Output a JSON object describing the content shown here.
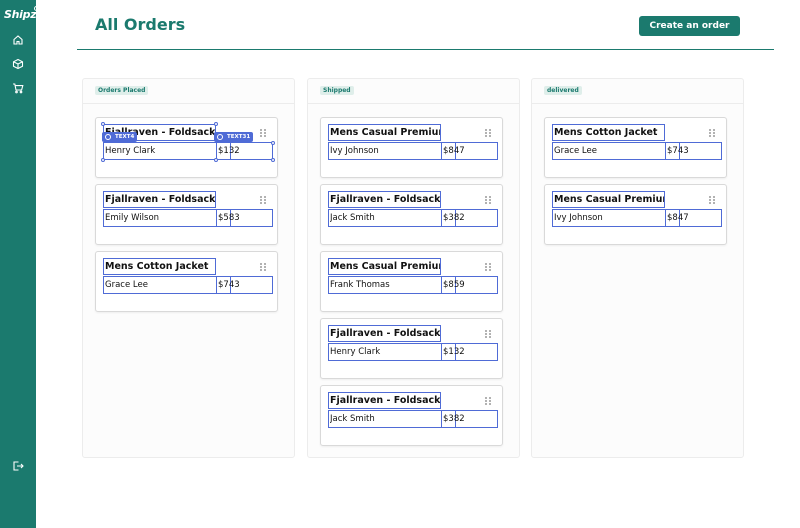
{
  "app": {
    "logo": "Shipz",
    "logout_icon": "logout-icon"
  },
  "sidebar": {
    "icons": [
      "home-icon",
      "box-icon",
      "cart-icon"
    ]
  },
  "header": {
    "title": "All Orders",
    "create_label": "Create an order"
  },
  "colors": {
    "brand": "#1b7a6e",
    "selection": "#4f6bd6"
  },
  "editor": {
    "tag_a": "TEXT4",
    "tag_b": "TEXT31"
  },
  "columns": [
    {
      "label": "Orders Placed",
      "cards": [
        {
          "title": "Fjallraven - Foldsack No.",
          "name": "Henry Clark",
          "price": "$132"
        },
        {
          "title": "Fjallraven - Foldsack No.",
          "name": "Emily Wilson",
          "price": "$583"
        },
        {
          "title": "Mens Cotton Jacket",
          "name": "Grace Lee",
          "price": "$743"
        }
      ]
    },
    {
      "label": "Shipped",
      "cards": [
        {
          "title": "Mens Casual Premium Sl",
          "name": "Ivy Johnson",
          "price": "$847"
        },
        {
          "title": "Fjallraven - Foldsack No.",
          "name": "Jack Smith",
          "price": "$382"
        },
        {
          "title": "Mens Casual Premium Sl",
          "name": "Frank Thomas",
          "price": "$859"
        },
        {
          "title": "Fjallraven - Foldsack No.",
          "name": "Henry Clark",
          "price": "$132"
        },
        {
          "title": "Fjallraven - Foldsack No.",
          "name": "Jack Smith",
          "price": "$382"
        }
      ]
    },
    {
      "label": "delivered",
      "cards": [
        {
          "title": "Mens Cotton Jacket",
          "name": "Grace Lee",
          "price": "$743"
        },
        {
          "title": "Mens Casual Premium Sl",
          "name": "Ivy Johnson",
          "price": "$847"
        }
      ]
    }
  ]
}
